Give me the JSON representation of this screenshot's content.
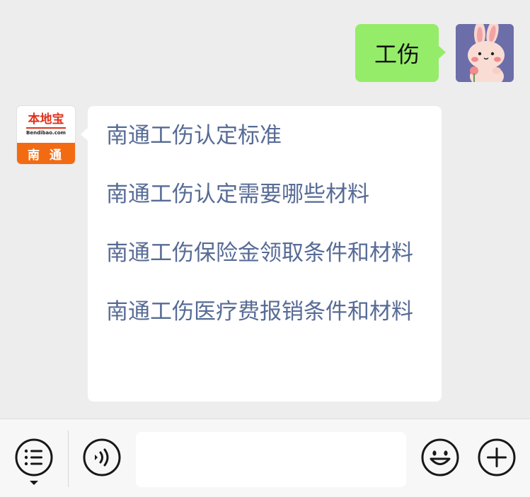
{
  "user_message": {
    "text": "工伤"
  },
  "bot_avatar": {
    "brand": "本地宝",
    "domain": "Bendibao.com",
    "city": "南 通"
  },
  "bot_message": {
    "links": [
      "南通工伤认定标准",
      "南通工伤认定需要哪些材料",
      "南通工伤保险金领取条件和材料",
      "南通工伤医疗费报销条件和材料"
    ]
  },
  "input_bar": {
    "input_value": "",
    "icons": [
      "menu-list-icon",
      "voice-icon",
      "emoji-icon",
      "plus-icon"
    ]
  },
  "colors": {
    "background": "#ededed",
    "outgoing_bubble": "#95ec69",
    "incoming_bubble": "#ffffff",
    "link": "#576b95",
    "brand_red": "#e0321b",
    "brand_orange": "#f26b13"
  }
}
